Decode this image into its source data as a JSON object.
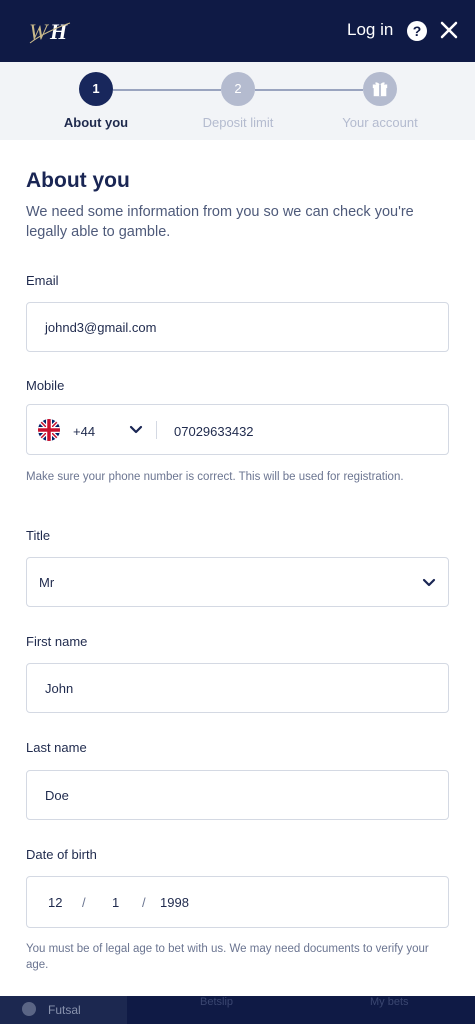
{
  "header": {
    "logo_alt": "WH",
    "login_label": "Log in",
    "help_icon": "help-icon",
    "close_icon": "close-icon"
  },
  "stepper": {
    "steps": [
      {
        "number": "1",
        "label": "About you",
        "state": "active"
      },
      {
        "number": "2",
        "label": "Deposit limit",
        "state": "inactive"
      },
      {
        "number": "",
        "label": "Your account",
        "icon": "gift-icon",
        "state": "inactive"
      }
    ]
  },
  "form": {
    "title": "About you",
    "intro": "We need some information from you so we can check you're legally able to gamble.",
    "email": {
      "label": "Email",
      "value": "johnd3@gmail.com"
    },
    "mobile": {
      "label": "Mobile",
      "country_icon": "uk-flag-icon",
      "dial_code": "+44",
      "number": "07029633432",
      "hint": "Make sure your phone number is correct. This will be used for registration."
    },
    "title_field": {
      "label": "Title",
      "value": "Mr"
    },
    "first_name": {
      "label": "First name",
      "value": "John"
    },
    "last_name": {
      "label": "Last name",
      "value": "Doe"
    },
    "dob": {
      "label": "Date of birth",
      "day": "12",
      "month": "1",
      "year": "1998",
      "separator": "/",
      "hint": "You must be of legal age to bet with us. We may need documents to verify your age."
    }
  },
  "bottom_nav": {
    "active_tab": "Futsal",
    "ghost_1": "Betslip",
    "ghost_2": "My bets"
  },
  "colors": {
    "header_bg": "#0f1a45",
    "step_active": "#18275c",
    "step_inactive": "#b4bbcf",
    "border": "#d4d9e3"
  }
}
